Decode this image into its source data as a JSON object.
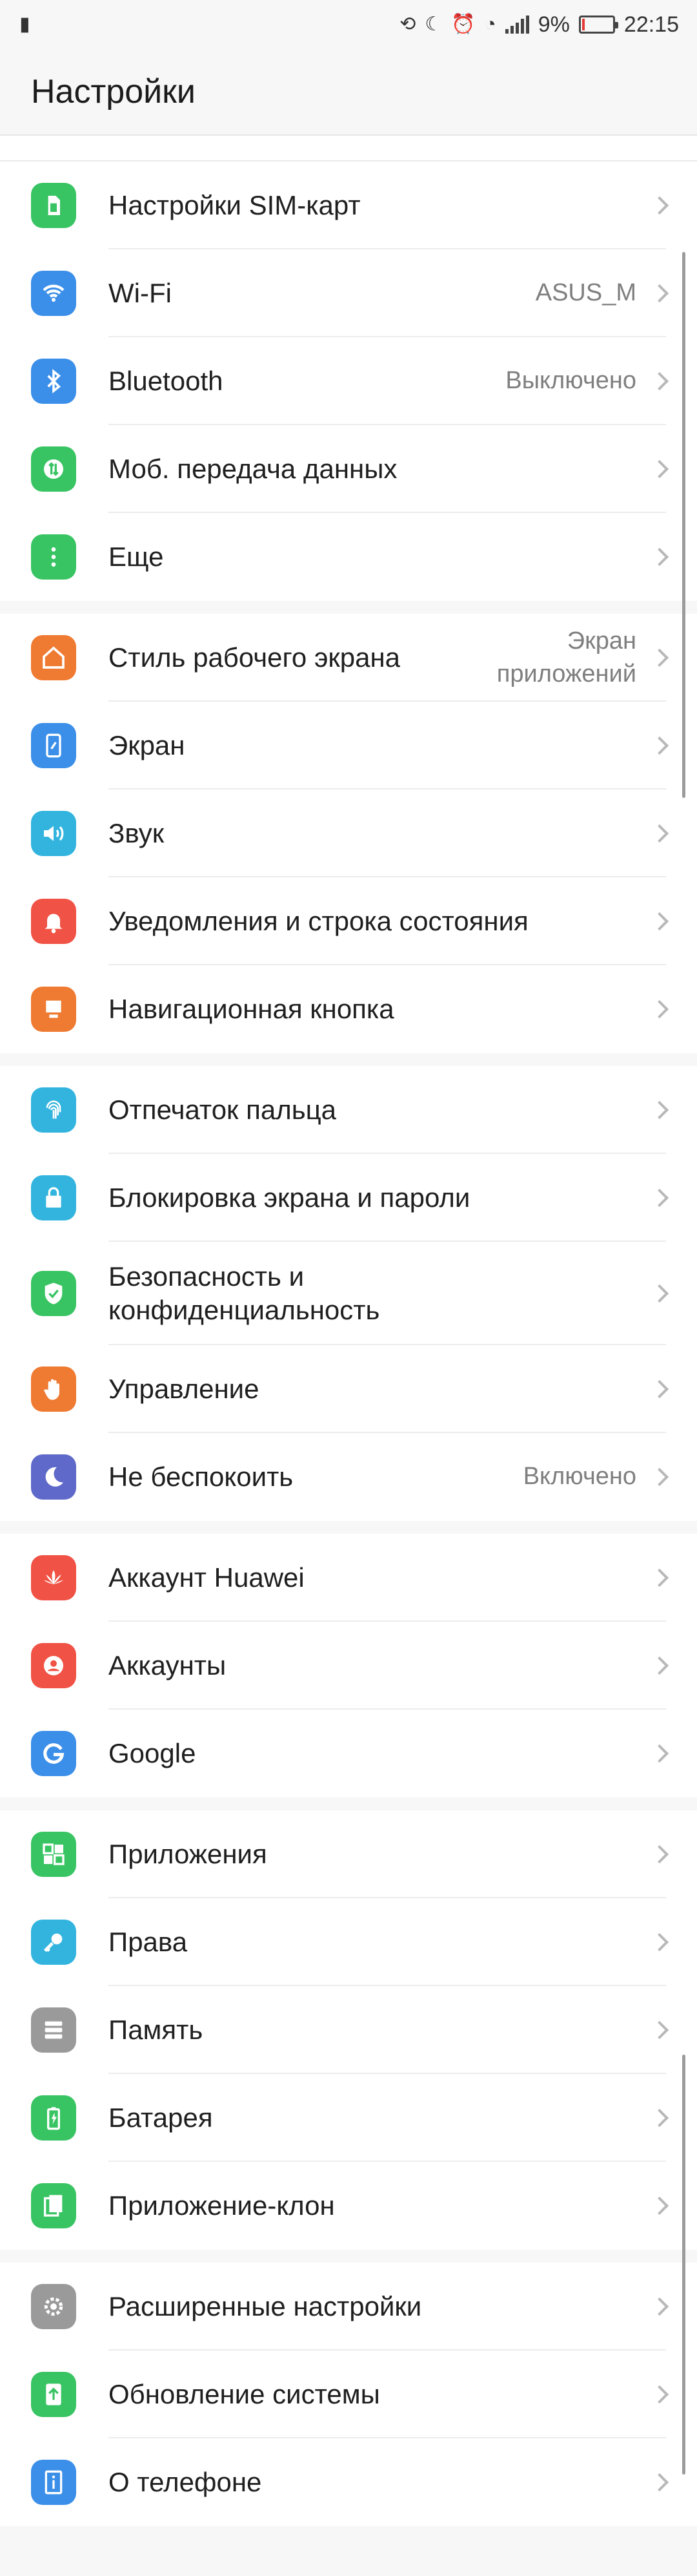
{
  "status": {
    "battery_percent": "9%",
    "time": "22:15",
    "battery_level_fraction": 0.09
  },
  "header": {
    "title": "Настройки"
  },
  "groups": [
    {
      "items": [
        {
          "label": "Настройки SIM-карт",
          "icon": "sim-card-icon",
          "color": "#39c463"
        },
        {
          "label": "Wi-Fi",
          "value": "ASUS_M",
          "icon": "wifi-icon",
          "color": "#3b8fe8"
        },
        {
          "label": "Bluetooth",
          "value": "Выключено",
          "icon": "bluetooth-icon",
          "color": "#3b8fe8"
        },
        {
          "label": "Моб. передача данных",
          "icon": "mobile-data-icon",
          "color": "#39c463"
        },
        {
          "label": "Еще",
          "icon": "more-icon",
          "color": "#39c463"
        }
      ]
    },
    {
      "items": [
        {
          "label": "Стиль рабочего экрана",
          "value_lines": [
            "Экран",
            "приложений"
          ],
          "icon": "home-style-icon",
          "color": "#ef7a31"
        },
        {
          "label": "Экран",
          "icon": "display-icon",
          "color": "#3b8fe8"
        },
        {
          "label": "Звук",
          "icon": "sound-icon",
          "color": "#32b4de"
        },
        {
          "label": "Уведомления и строка состояния",
          "icon": "notifications-icon",
          "color": "#f05245"
        },
        {
          "label": "Навигационная кнопка",
          "icon": "navigation-button-icon",
          "color": "#ef7a31"
        }
      ]
    },
    {
      "items": [
        {
          "label": "Отпечаток пальца",
          "icon": "fingerprint-icon",
          "color": "#32b4de"
        },
        {
          "label": "Блокировка экрана и пароли",
          "icon": "lock-icon",
          "color": "#32b4de"
        },
        {
          "label_lines": [
            "Безопасность и",
            "конфиденциальность"
          ],
          "icon": "shield-icon",
          "color": "#39c463"
        },
        {
          "label": "Управление",
          "icon": "hand-icon",
          "color": "#ef7a31"
        },
        {
          "label": "Не беспокоить",
          "value": "Включено",
          "icon": "moon-icon",
          "color": "#5f69c9"
        }
      ]
    },
    {
      "items": [
        {
          "label": "Аккаунт Huawei",
          "icon": "huawei-logo-icon",
          "color": "#f05245"
        },
        {
          "label": "Аккаунты",
          "icon": "account-icon",
          "color": "#f05245"
        },
        {
          "label": "Google",
          "icon": "google-icon",
          "color": "#3b8fe8"
        }
      ]
    },
    {
      "items": [
        {
          "label": "Приложения",
          "icon": "apps-icon",
          "color": "#39c463"
        },
        {
          "label": "Права",
          "icon": "key-icon",
          "color": "#32b4de"
        },
        {
          "label": "Память",
          "icon": "storage-icon",
          "color": "#9a9a9a"
        },
        {
          "label": "Батарея",
          "icon": "battery-icon",
          "color": "#39c463"
        },
        {
          "label": "Приложение-клон",
          "icon": "app-clone-icon",
          "color": "#39c463"
        }
      ]
    },
    {
      "items": [
        {
          "label": "Расширенные настройки",
          "icon": "gear-icon",
          "color": "#9a9a9a"
        },
        {
          "label": "Обновление системы",
          "icon": "system-update-icon",
          "color": "#39c463"
        },
        {
          "label": "О телефоне",
          "icon": "info-icon",
          "color": "#3b8fe8"
        }
      ]
    }
  ]
}
